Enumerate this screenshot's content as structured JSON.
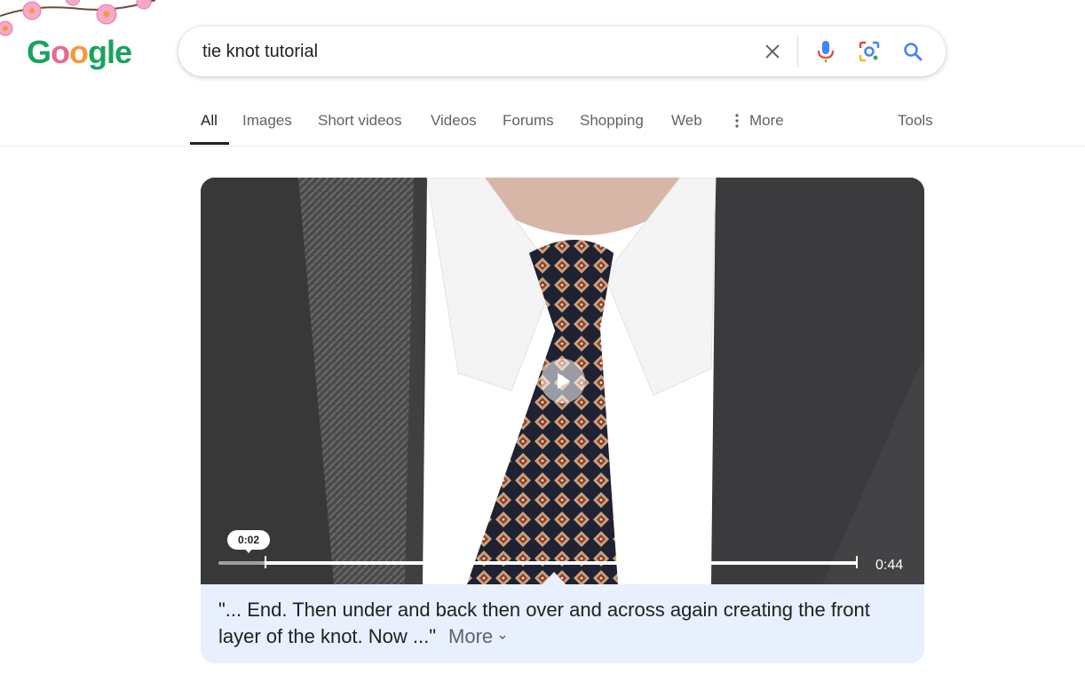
{
  "logo": {
    "letters": [
      "G",
      "o",
      "o",
      "g",
      "l",
      "e"
    ]
  },
  "search": {
    "query": "tie knot tutorial"
  },
  "tabs": [
    {
      "label": "All",
      "active": true
    },
    {
      "label": "Images"
    },
    {
      "label": "Short videos"
    },
    {
      "label": "Videos"
    },
    {
      "label": "Forums"
    },
    {
      "label": "Shopping"
    },
    {
      "label": "Web"
    },
    {
      "label": "More"
    },
    {
      "label": "Tools"
    }
  ],
  "video": {
    "current_time": "0:02",
    "duration": "0:44",
    "progress_fraction": 0.045,
    "caption": "\"... End. Then under and back then over and across again creating the front layer of the knot. Now ...\"",
    "more_label": "More"
  },
  "colors": {
    "accent_blue": "#4285f4",
    "caption_bg": "#e8f0fe"
  }
}
